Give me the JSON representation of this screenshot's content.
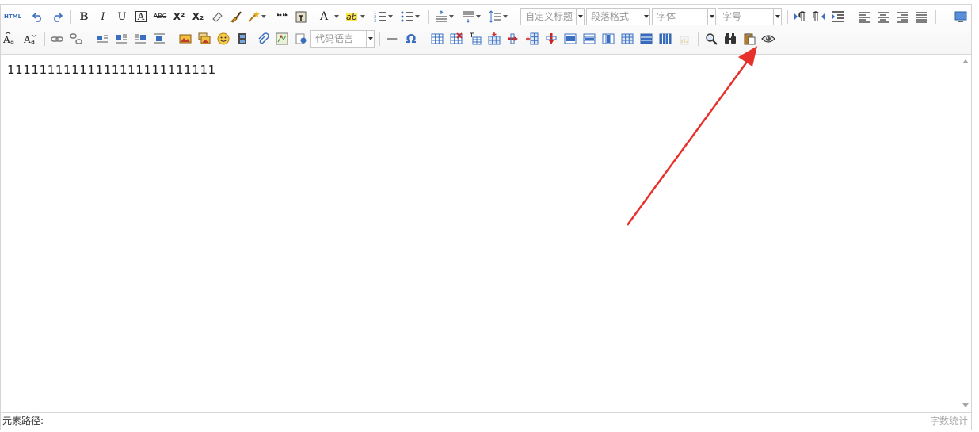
{
  "toolbar": {
    "html_label": "HTML",
    "bold": "B",
    "italic": "I",
    "underline": "U",
    "fontborder": "A",
    "strike": "ABC",
    "superscript": "X²",
    "subscript": "X₂",
    "blockquote": "❝❝",
    "forecolor": "A",
    "backcolor": "ab",
    "omega": "Ω",
    "hr": "—",
    "combos": {
      "custom_style": "自定义标题",
      "paragraph": "段落格式",
      "font_family": "字体",
      "font_size": "字号",
      "code_language": "代码语言"
    }
  },
  "editor": {
    "content": "11111111111111111111111111"
  },
  "statusbar": {
    "element_path_label": "元素路径:",
    "word_count": "字数统计"
  },
  "colors": {
    "annotation_arrow": "#e8302a",
    "icon_blue": "#3a6fc0",
    "toolbar_border": "#d4d4d4"
  }
}
